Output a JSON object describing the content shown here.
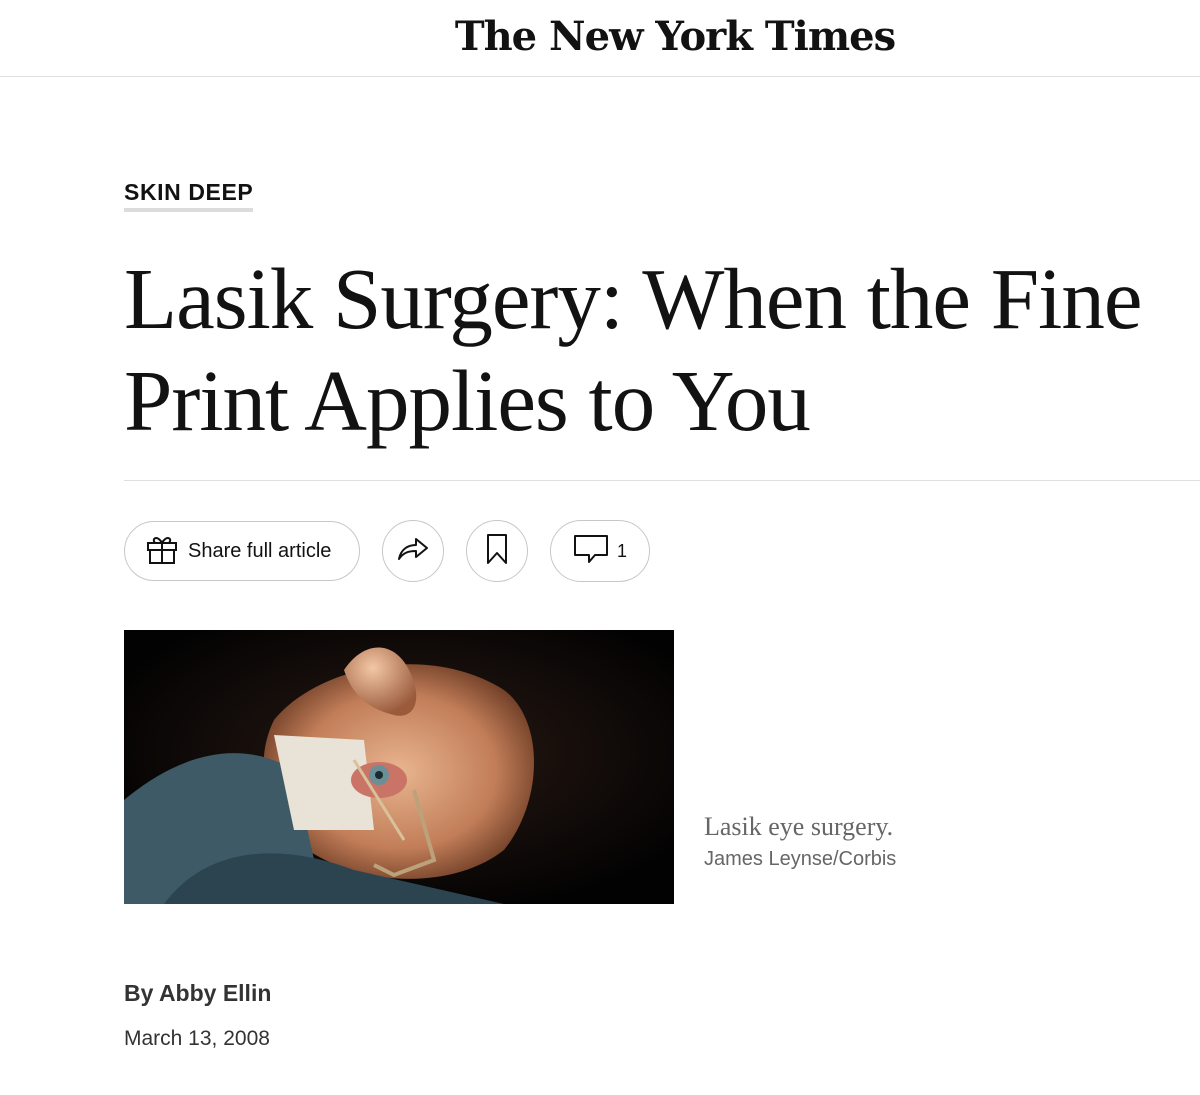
{
  "masthead": {
    "title": "The New York Times"
  },
  "article": {
    "kicker": "SKIN DEEP",
    "headline": "Lasik Surgery: When the Fine Print Applies to You",
    "toolbar": {
      "share_full_label": "Share full article",
      "share_icon": "gift-icon",
      "forward_icon": "share-arrow-icon",
      "bookmark_icon": "bookmark-icon",
      "comment_icon": "comment-icon",
      "comment_count": "1"
    },
    "image": {
      "caption": "Lasik eye surgery.",
      "credit": "James Leynse/Corbis"
    },
    "byline": "By Abby Ellin",
    "date": "March 13, 2008"
  }
}
